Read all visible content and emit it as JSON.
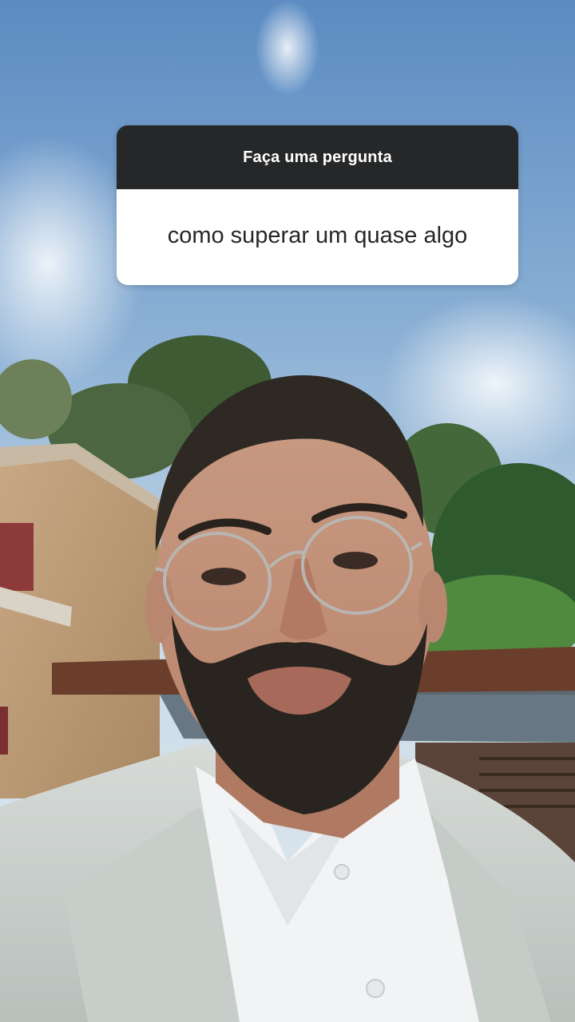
{
  "question_sticker": {
    "title": "Faça uma pergunta",
    "question": "como superar um quase algo"
  },
  "colors": {
    "sticker_header_bg": "#262728",
    "sticker_body_bg": "#ffffff",
    "sky_top": "#5f8fc4",
    "sky_bottom": "#dbe6ee"
  }
}
